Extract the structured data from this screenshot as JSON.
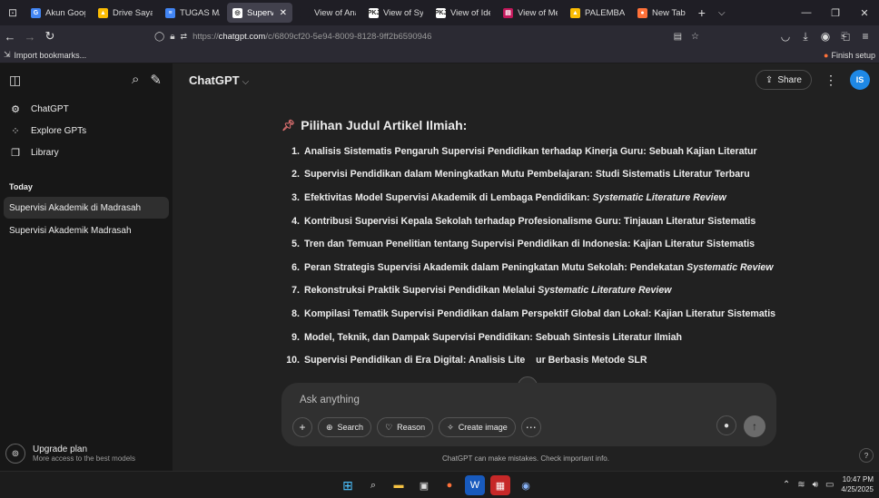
{
  "browser": {
    "tabs": [
      {
        "title": "Akun Googl",
        "favicon_color": "#4285f4",
        "favicon": "G"
      },
      {
        "title": "Drive Saya",
        "favicon_color": "#fbbc04",
        "favicon": "▲"
      },
      {
        "title": "TUGAS MAT",
        "favicon_color": "#4285f4",
        "favicon": "≡"
      },
      {
        "title": "Supervisi",
        "favicon_color": "#ffffff",
        "favicon": "◎",
        "active": true
      },
      {
        "title": "View of Analisis",
        "favicon_color": "#1f1e25",
        "favicon": ""
      },
      {
        "title": "View of Syst",
        "favicon_color": "#ffffff",
        "favicon": "PKJ"
      },
      {
        "title": "View of Iden",
        "favicon_color": "#ffffff",
        "favicon": "PKJ"
      },
      {
        "title": "View of Met",
        "favicon_color": "#c2185b",
        "favicon": "▤"
      },
      {
        "title": "PALEMBANG",
        "favicon_color": "#fbbc04",
        "favicon": "▲"
      },
      {
        "title": "New Tab",
        "favicon_color": "#ff7139",
        "favicon": "●"
      }
    ],
    "close_glyph": "✕",
    "url_prefix": "https://",
    "url_host": "chatgpt.com",
    "url_path": "/c/6809cf20-5e94-8009-8128-9ff2b6590946",
    "bookmarks": {
      "import": "Import bookmarks...",
      "finish": "Finish setup"
    }
  },
  "sidebar": {
    "nav": [
      {
        "label": "ChatGPT",
        "icon": "openai-icon"
      },
      {
        "label": "Explore GPTs",
        "icon": "grid-icon"
      },
      {
        "label": "Library",
        "icon": "library-icon"
      }
    ],
    "section": "Today",
    "chats": [
      {
        "label": "Supervisi Akademik di Madrasah",
        "active": true
      },
      {
        "label": "Supervisi Akademik Madrasah",
        "active": false
      }
    ],
    "upgrade": {
      "title": "Upgrade plan",
      "subtitle": "More access to the best models"
    }
  },
  "header": {
    "model": "ChatGPT",
    "share": "Share",
    "avatar": "IS"
  },
  "message": {
    "heading": "Pilihan Judul Artikel Ilmiah:",
    "items": [
      {
        "num": "1.",
        "text": "Analisis Sistematis Pengaruh Supervisi Pendidikan terhadap Kinerja Guru: Sebuah Kajian Literatur",
        "em": ""
      },
      {
        "num": "2.",
        "text": "Supervisi Pendidikan dalam Meningkatkan Mutu Pembelajaran: Studi Sistematis Literatur Terbaru",
        "em": ""
      },
      {
        "num": "3.",
        "text": "Efektivitas Model Supervisi Akademik di Lembaga Pendidikan: ",
        "em": "Systematic Literature Review"
      },
      {
        "num": "4.",
        "text": "Kontribusi Supervisi Kepala Sekolah terhadap Profesionalisme Guru: Tinjauan Literatur Sistematis",
        "em": ""
      },
      {
        "num": "5.",
        "text": "Tren dan Temuan Penelitian tentang Supervisi Pendidikan di Indonesia: Kajian Literatur Sistematis",
        "em": ""
      },
      {
        "num": "6.",
        "text": "Peran Strategis Supervisi Akademik dalam Peningkatan Mutu Sekolah: Pendekatan ",
        "em": "Systematic Review"
      },
      {
        "num": "7.",
        "text": "Rekonstruksi Praktik Supervisi Pendidikan Melalui ",
        "em": "Systematic Literature Review"
      },
      {
        "num": "8.",
        "text": "Kompilasi Tematik Supervisi Pendidikan dalam Perspektif Global dan Lokal: Kajian Literatur Sistematis",
        "em": ""
      },
      {
        "num": "9.",
        "text": "Model, Teknik, dan Dampak Supervisi Pendidikan: Sebuah Sintesis Literatur Ilmiah",
        "em": ""
      },
      {
        "num": "10.",
        "text": "Supervisi Pendidikan di Era Digital: Analisis Lite    ur Berbasis Metode SLR",
        "em": ""
      }
    ]
  },
  "composer": {
    "placeholder": "Ask anything",
    "tools": {
      "search": "Search",
      "reason": "Reason",
      "image": "Create image"
    },
    "disclaimer": "ChatGPT can make mistakes. Check important info."
  },
  "taskbar": {
    "time": "10:47 PM",
    "date": "4/25/2025"
  }
}
